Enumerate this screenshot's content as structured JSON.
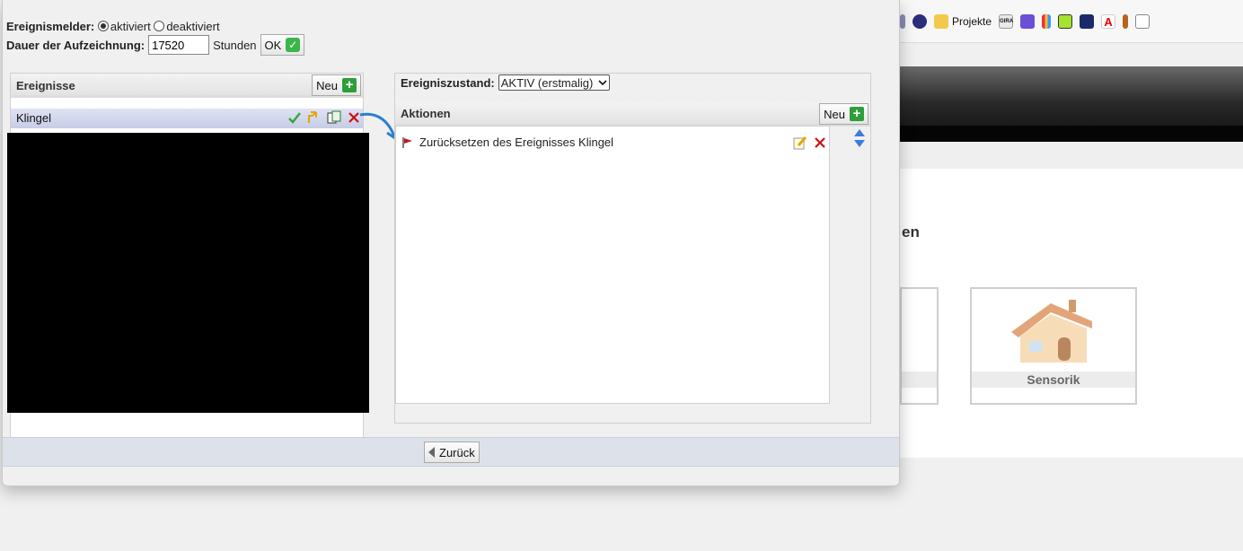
{
  "bookmarks": {
    "projekte_label": "Projekte",
    "gira_label": "GIRA",
    "adobe_label": "A"
  },
  "background": {
    "heading_fragment": "en",
    "tile_caption": "Sensorik"
  },
  "settings": {
    "event_reporter_label": "Ereignismelder:",
    "activated_label": "aktiviert",
    "deactivated_label": "deaktiviert",
    "recording_duration_label": "Dauer der Aufzeichnung:",
    "recording_duration_value": "17520",
    "hours_label": "Stunden",
    "ok_label": "OK"
  },
  "events_panel": {
    "title": "Ereignisse",
    "new_label": "Neu",
    "items": [
      {
        "name": "Klingel"
      }
    ]
  },
  "state": {
    "label": "Ereigniszustand:",
    "selected": "AKTIV (erstmalig)"
  },
  "actions_panel": {
    "title": "Aktionen",
    "new_label": "Neu",
    "items": [
      {
        "label": "Zurücksetzen des Ereignisses Klingel"
      }
    ]
  },
  "footer": {
    "back_label": "Zurück"
  }
}
